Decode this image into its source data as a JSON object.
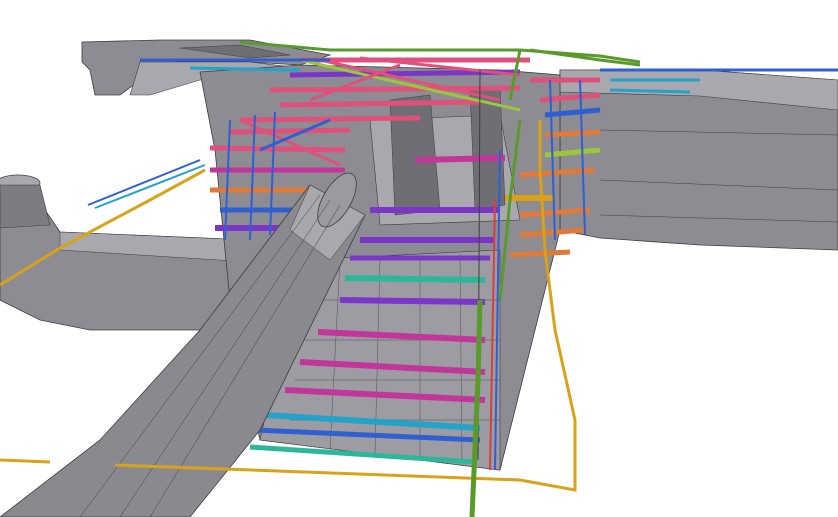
{
  "model": {
    "description_visible_text": "",
    "colors": {
      "background": "#ffffff",
      "concrete": "#8d8c92",
      "concrete_light": "#a9a8ae",
      "concrete_dark": "#6f6e74",
      "edge": "#3c3c40",
      "pipe": "#8a898f",
      "pink": "#e0507a",
      "magenta": "#c2359a",
      "purple": "#7b35c8",
      "blue": "#2f5fd0",
      "cyan": "#23a3c9",
      "teal": "#2cb79a",
      "orange": "#e07a3a",
      "lime": "#9bc83a",
      "green": "#5a9a2a",
      "yellow": "#d9a21a",
      "red": "#d84040"
    }
  }
}
